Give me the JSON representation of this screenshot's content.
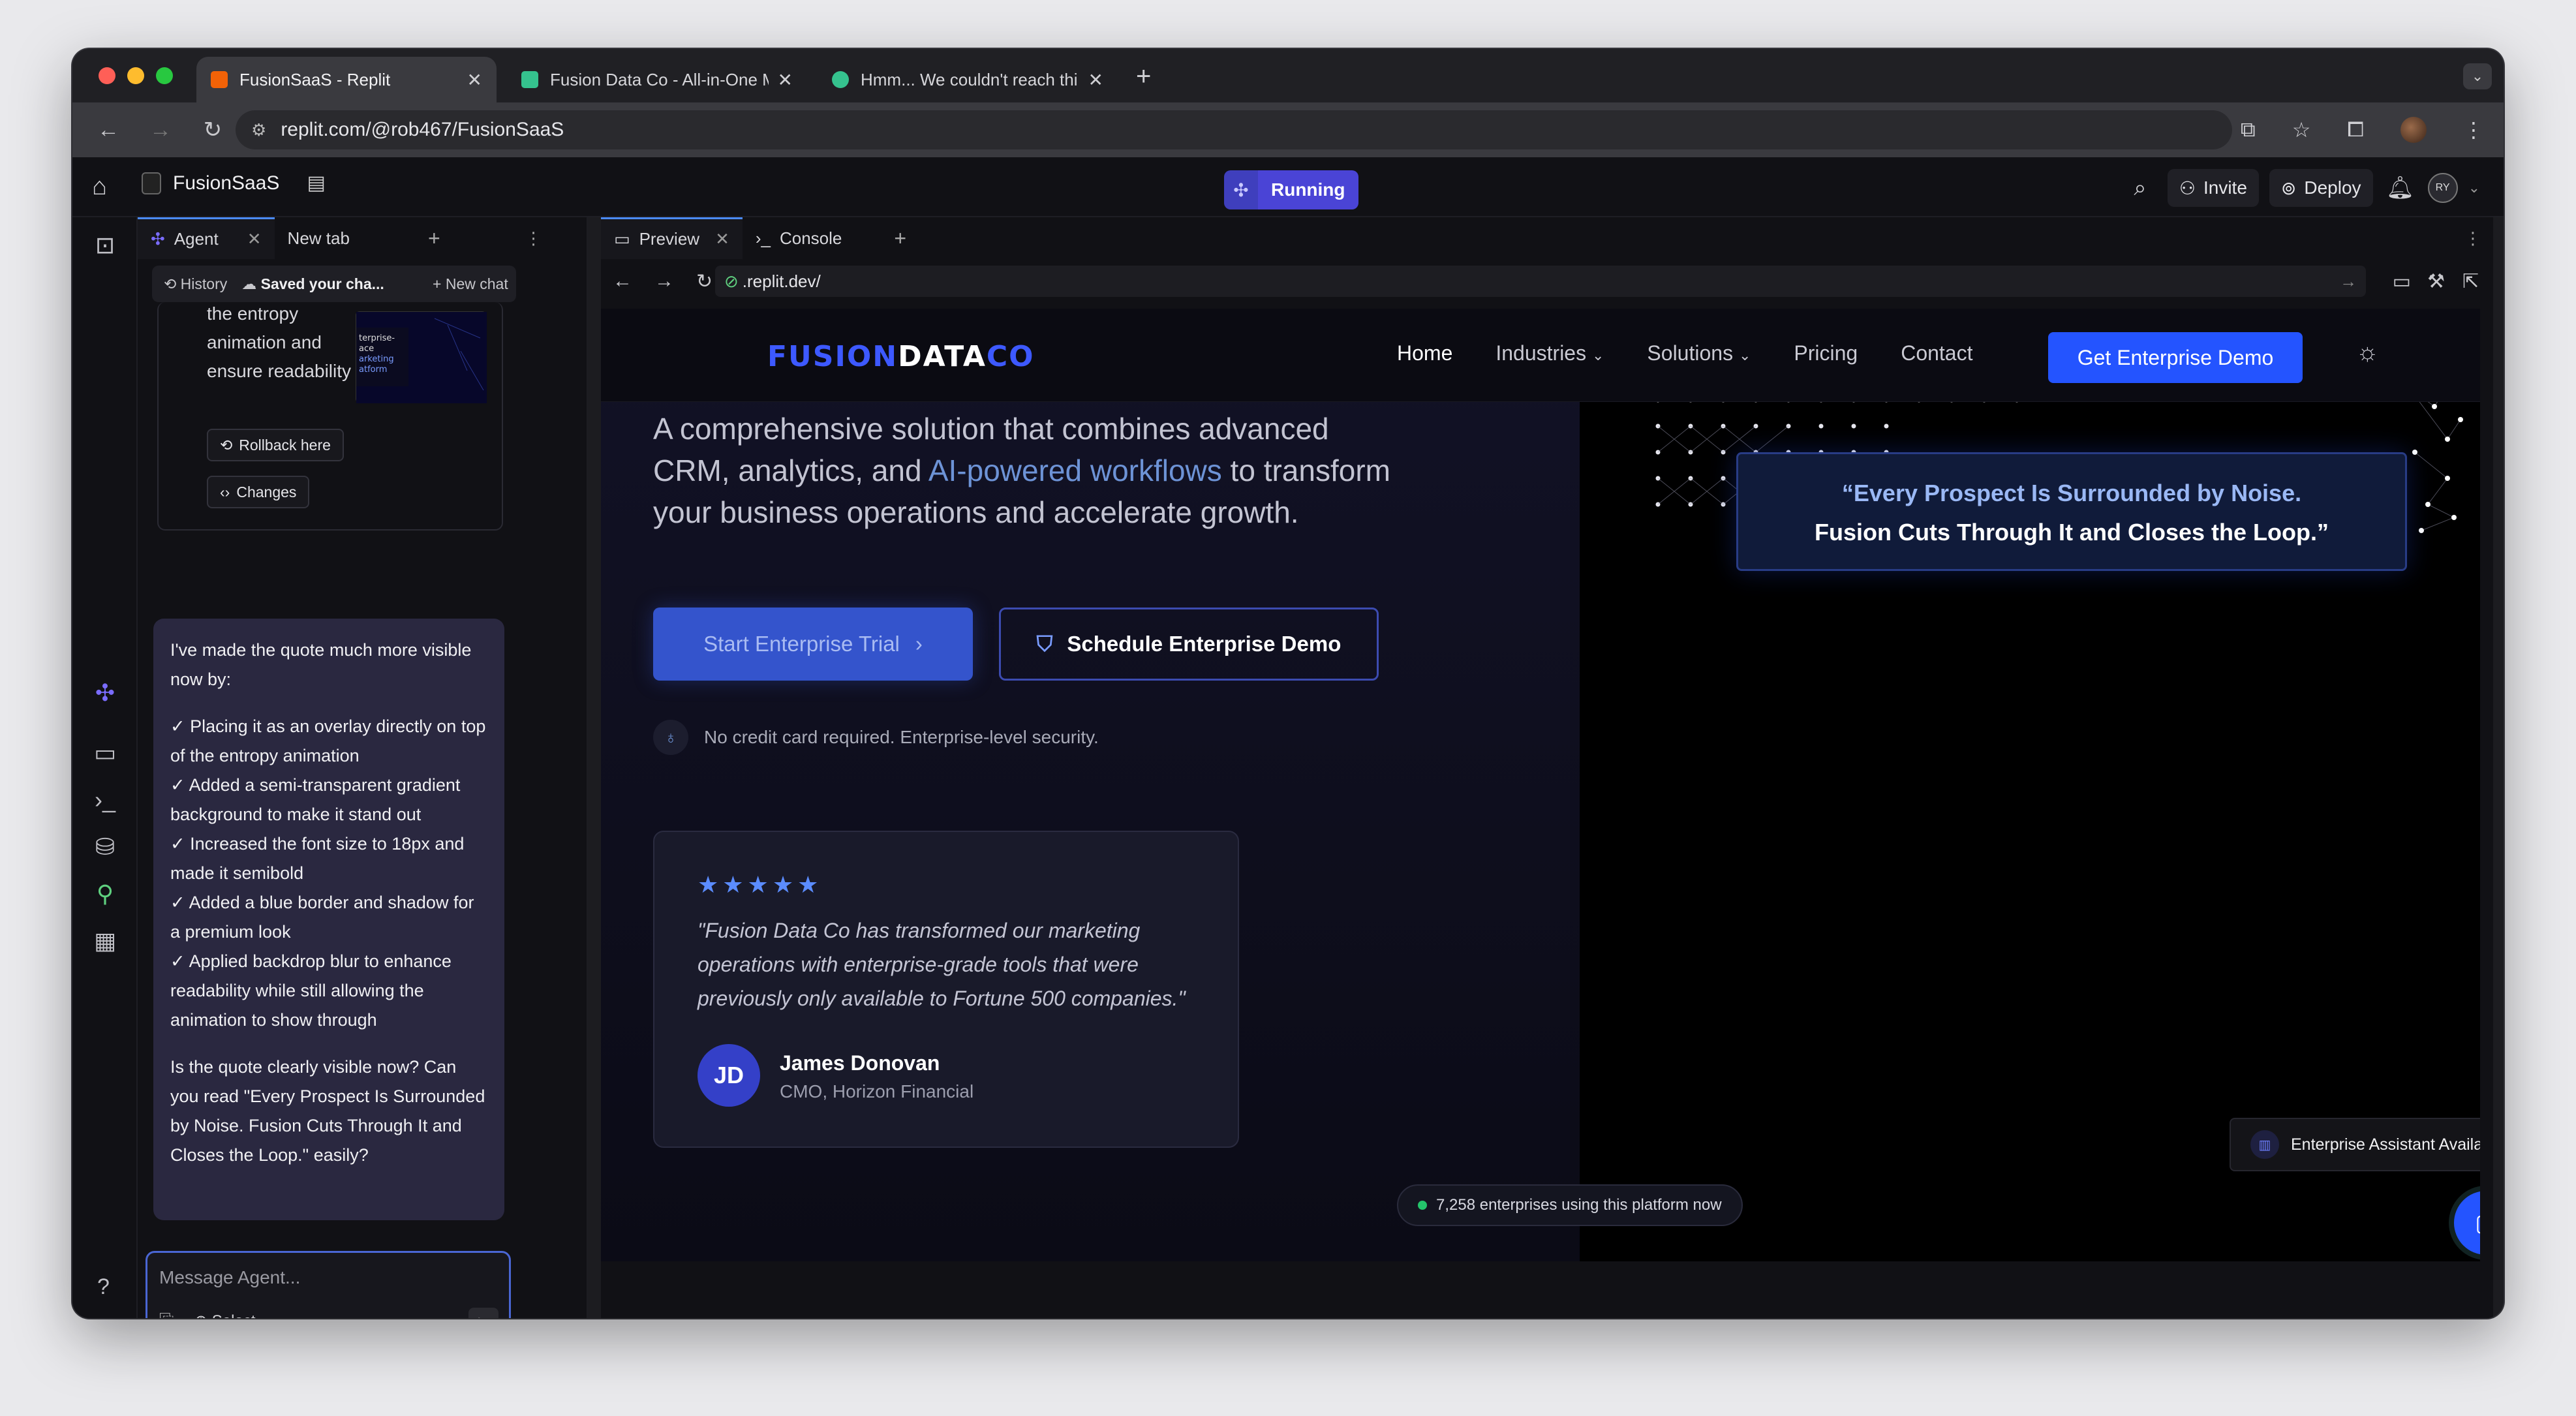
{
  "browser": {
    "tabs": [
      {
        "title": "FusionSaaS - Replit",
        "fav_color": "#f26207"
      },
      {
        "title": "Fusion Data Co - All-in-One M",
        "fav_color": "#35c28e"
      },
      {
        "title": "Hmm... We couldn't reach thi",
        "fav_color": "#35c28e"
      }
    ],
    "url": "replit.com/@rob467/FusionSaaS"
  },
  "replit_header": {
    "project": "FusionSaaS",
    "status": "Running",
    "invite": "Invite",
    "deploy": "Deploy",
    "avatar": "RY"
  },
  "agent": {
    "tabs": {
      "agent": "Agent",
      "new_tab": "New tab"
    },
    "sub": {
      "history": "History",
      "saved": "Saved your cha...",
      "new_chat": "New chat"
    },
    "prev_card_text": "the entropy animation and ensure readability",
    "rollback": "Rollback here",
    "changes": "Changes",
    "message": {
      "intro": "I've made the quote much more visible now by:",
      "items": [
        "✓ Placing it as an overlay directly on top of the entropy animation",
        "✓ Added a semi-transparent gradient background to make it stand out",
        "✓ Increased the font size to 18px and made it semibold",
        "✓ Added a blue border and shadow for a premium look",
        "✓ Applied backdrop blur to enhance readability while still allowing the animation to show through"
      ],
      "question": "Is the quote clearly visible now? Can you read \"Every Prospect Is Surrounded by Noise. Fusion Cuts Through It and Closes the Loop.\" easily?"
    },
    "input_placeholder": "Message Agent...",
    "select": "Select"
  },
  "preview": {
    "tabs": {
      "preview": "Preview",
      "console": "Console"
    },
    "url": ".replit.dev/"
  },
  "site": {
    "logo_a": "FUSION",
    "logo_b": "DATA",
    "logo_c": "CO",
    "nav": {
      "home": "Home",
      "industries": "Industries",
      "solutions": "Solutions",
      "pricing": "Pricing",
      "contact": "Contact"
    },
    "cta": "Get Enterprise Demo",
    "hero_a": "A comprehensive solution that combines advanced CRM, analytics, and ",
    "hero_hl": "AI-powered workflows",
    "hero_b": " to transform your business operations and accelerate growth.",
    "btn_trial": "Start Enterprise Trial",
    "btn_demo": "Schedule Enterprise Demo",
    "note": "No credit card required. Enterprise-level security.",
    "testimonial": {
      "stars": "★★★★★",
      "quote": "\"Fusion Data Co has transformed our marketing operations with enterprise-grade tools that were previously only available to Fortune 500 companies.\"",
      "initials": "JD",
      "name": "James Donovan",
      "role": "CMO, Horizon Financial"
    },
    "quote_line1": "“Every Prospect Is Surrounded by Noise.",
    "quote_line2": "Fusion Cuts Through It and Closes the Loop.”",
    "live": "7,258 enterprises using this platform now",
    "assistant": "Enterprise Assistant Available"
  }
}
